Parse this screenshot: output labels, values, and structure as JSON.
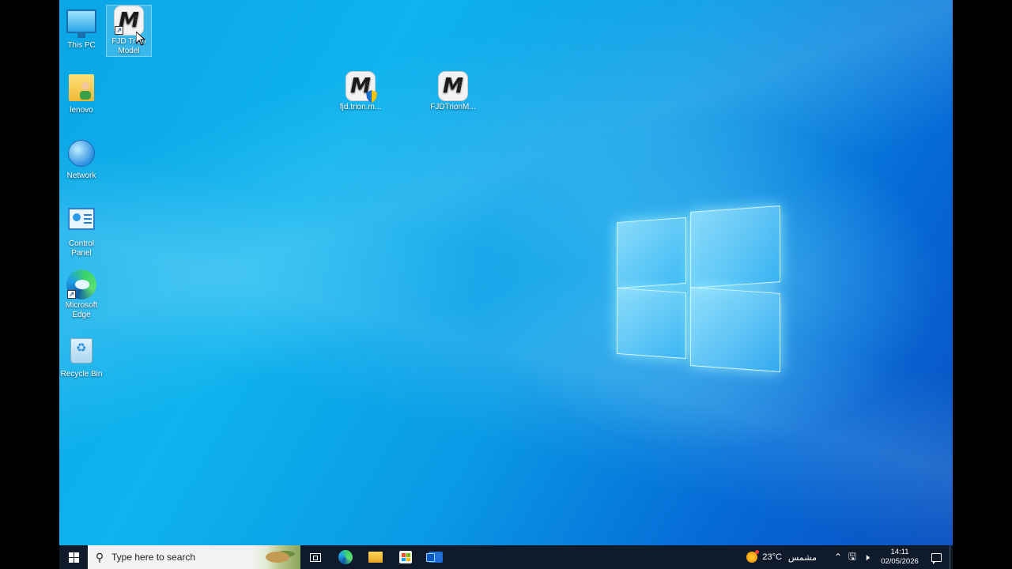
{
  "desktop": {
    "icons": [
      {
        "label": "This PC",
        "icon": "this-pc-icon"
      },
      {
        "label": "FJD Trion Model",
        "icon": "fjd-trion-model-icon"
      },
      {
        "label": "lenovo",
        "icon": "user-folder-icon"
      },
      {
        "label": "fjd.trion.m...",
        "icon": "fjd-installer-icon"
      },
      {
        "label": "FJDTrionM...",
        "icon": "fjd-trion-app-icon"
      },
      {
        "label": "Network",
        "icon": "network-icon"
      },
      {
        "label": "Control Panel",
        "icon": "control-panel-icon"
      },
      {
        "label": "Microsoft Edge",
        "icon": "edge-icon"
      },
      {
        "label": "Recycle Bin",
        "icon": "recycle-bin-icon"
      }
    ],
    "selected_icon": "FJD Trion Model"
  },
  "taskbar": {
    "search_placeholder": "Type here to search",
    "pinned": [
      "task-view-icon",
      "edge-icon",
      "file-explorer-icon",
      "microsoft-store-icon",
      "outlook-icon"
    ],
    "weather": {
      "temperature": "23°C",
      "condition": "مشمس"
    },
    "clock": {
      "time": "14:11",
      "date": "02/05/2026"
    }
  },
  "colors": {
    "taskbar_bg": "#0f1b2b",
    "wallpaper_primary": "#0aa6e6",
    "wallpaper_secondary": "#0569d6"
  }
}
